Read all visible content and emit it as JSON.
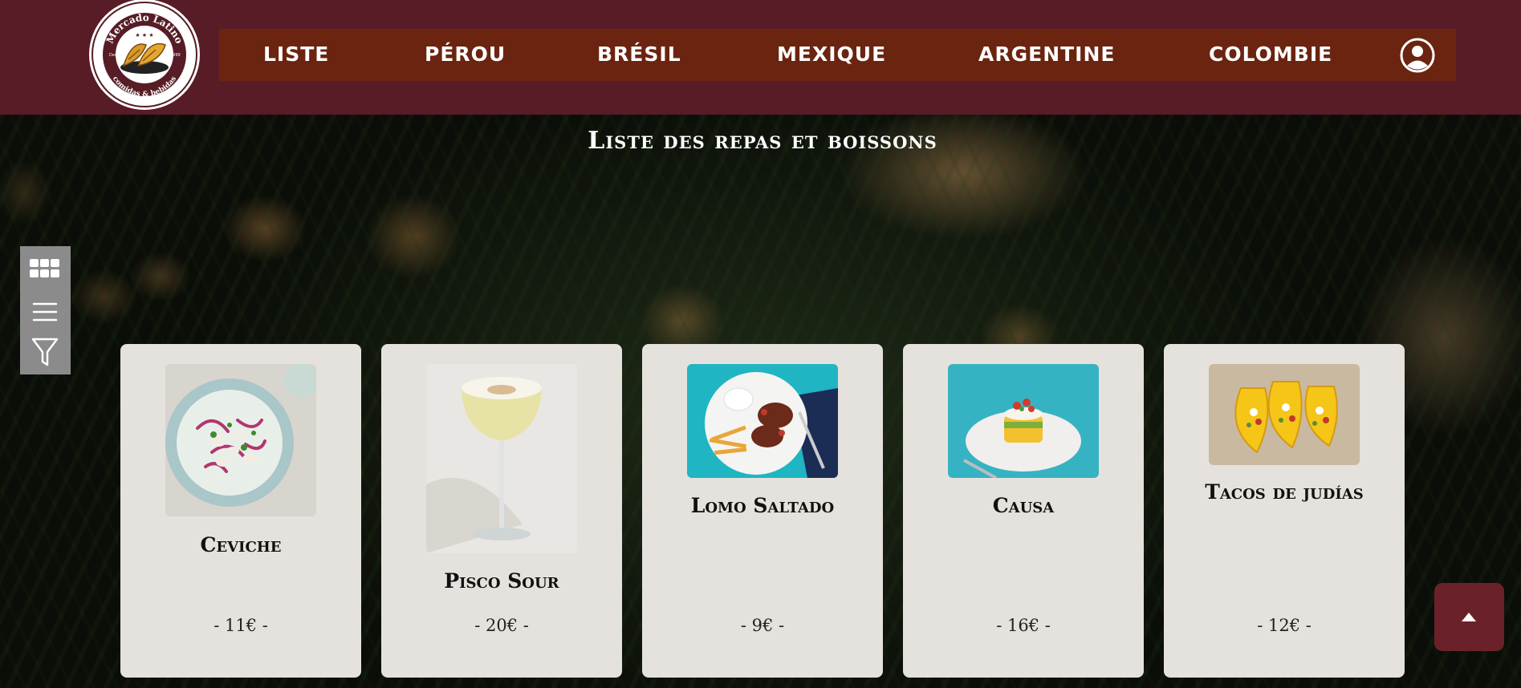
{
  "header": {
    "logo": {
      "top_text": "Mercado Latino",
      "bottom_text": "comidas & bebidas",
      "left_text": "Desde",
      "right_text": "1999"
    },
    "nav": [
      {
        "label": "LISTE"
      },
      {
        "label": "PÉROU"
      },
      {
        "label": "BRÉSIL"
      },
      {
        "label": "MEXIQUE"
      },
      {
        "label": "ARGENTINE"
      },
      {
        "label": "COLOMBIE"
      }
    ],
    "colors": {
      "header_bg": "#571c25",
      "nav_bg": "#6b2410"
    }
  },
  "page": {
    "title": "Liste des repas et boissons"
  },
  "toolbar": {
    "icons": [
      "grid-icon",
      "list-icon",
      "filter-icon"
    ]
  },
  "cards": [
    {
      "name": "Ceviche",
      "price": "- 11€ -"
    },
    {
      "name": "Pisco Sour",
      "price": "- 20€ -"
    },
    {
      "name": "Lomo Saltado",
      "price": "- 9€ -"
    },
    {
      "name": "Causa",
      "price": "- 16€ -"
    },
    {
      "name": "Tacos de judías",
      "price": "- 12€ -"
    }
  ],
  "scroll_top": {
    "icon": "arrow-up-icon"
  }
}
